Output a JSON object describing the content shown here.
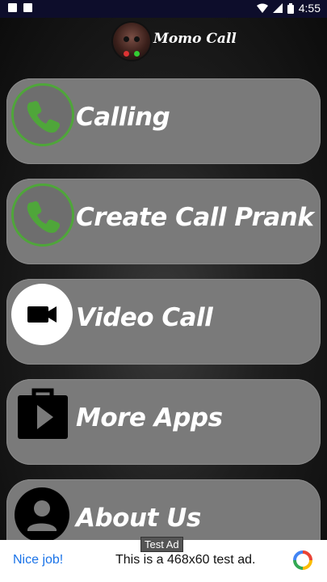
{
  "status_bar": {
    "time": "4:55"
  },
  "header": {
    "app_title": "Momo Call"
  },
  "menu": [
    {
      "label": "Calling",
      "icon": "phone-icon"
    },
    {
      "label": "Create Call Prank",
      "icon": "phone-icon"
    },
    {
      "label": "Video Call",
      "icon": "video-camera-icon"
    },
    {
      "label": "More Apps",
      "icon": "play-store-bag-icon"
    },
    {
      "label": "About Us",
      "icon": "person-icon"
    }
  ],
  "ad": {
    "tag": "Test Ad",
    "nice": "Nice job!",
    "description": "This is a 468x60 test ad."
  },
  "colors": {
    "button_bg": "#7a7a7a",
    "call_green": "#4fa63a",
    "status_bar": "#0d0d2b",
    "ad_link": "#1a73e8"
  }
}
